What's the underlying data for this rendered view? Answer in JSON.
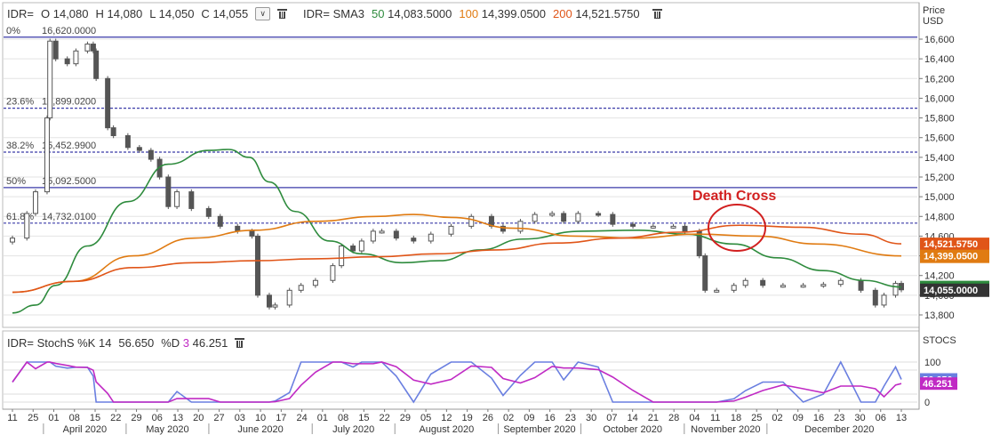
{
  "price_header": {
    "symbol": "IDR=",
    "o_label": "O",
    "o_val": "14,080",
    "h_label": "H",
    "h_val": "14,080",
    "l_label": "L",
    "l_val": "14,050",
    "c_label": "C",
    "c_val": "14,055",
    "dropdown_glyph": "∨",
    "sma_label": "IDR= SMA3",
    "sma50_period": "50",
    "sma50_val": "14,083.5000",
    "sma100_period": "100",
    "sma100_val": "14,399.0500",
    "sma200_period": "200",
    "sma200_val": "14,521.5750"
  },
  "price_axis_title": [
    "Price",
    "USD"
  ],
  "stoch_header": {
    "text": "IDR= StochS %K 14",
    "k_val": "56.650",
    "d_label": "%D",
    "d_period": "3",
    "d_val": "46.251"
  },
  "stoch_axis_title": "STOCS",
  "annotation": {
    "text": "Death Cross",
    "color": "#d22020"
  },
  "colors": {
    "candle": "#555555",
    "sma50": "#2e8b3d",
    "sma100": "#e07b12",
    "sma200": "#e05518",
    "fib": "#3a3aa8",
    "stoch_k": "#6a7fe0",
    "stoch_d": "#c02ac4",
    "last_price_bg": "#333333"
  },
  "fib_levels": [
    {
      "pct": "0%",
      "value": 16620.0,
      "label": "16,620.0000",
      "dashed": false
    },
    {
      "pct": "23.6%",
      "value": 15899.02,
      "label": "15,899.0200",
      "dashed": true
    },
    {
      "pct": "38.2%",
      "value": 15452.99,
      "label": "15,452.9900",
      "dashed": true
    },
    {
      "pct": "50%",
      "value": 15092.5,
      "label": "15,092.5000",
      "dashed": false
    },
    {
      "pct": "61.8%",
      "value": 14732.01,
      "label": "14,732.0100",
      "dashed": true
    }
  ],
  "price_badges": [
    {
      "value": 14521.575,
      "label": "14,521.5750",
      "color": "#e05518"
    },
    {
      "value": 14399.05,
      "label": "14,399.0500",
      "color": "#e07b12"
    },
    {
      "value": 14083.5,
      "label": "14,083.5000",
      "color": "#2e8b3d"
    },
    {
      "value": 14055.0,
      "label": "14,055.0000",
      "color": "#333333"
    }
  ],
  "stoch_badges": [
    {
      "value": 56.65,
      "label": "56.650",
      "color": "#6a7fe0"
    },
    {
      "value": 46.251,
      "label": "46.251",
      "color": "#c02ac4"
    }
  ],
  "x_axis": {
    "day_labels": [
      "11",
      "25",
      "01",
      "08",
      "15",
      "22",
      "29",
      "06",
      "13",
      "20",
      "27",
      "03",
      "10",
      "17",
      "24",
      "01",
      "08",
      "15",
      "22",
      "29",
      "05",
      "12",
      "19",
      "26",
      "02",
      "09",
      "16",
      "23",
      "30",
      "07",
      "14",
      "21",
      "28",
      "04",
      "11",
      "18",
      "25",
      "02",
      "09",
      "16",
      "23",
      "30",
      "06",
      "13"
    ],
    "months": [
      "April 2020",
      "May 2020",
      "June 2020",
      "July 2020",
      "August 2020",
      "September 2020",
      "October 2020",
      "November 2020",
      "December 2020"
    ]
  },
  "chart_data": {
    "type": "candlestick",
    "title": "",
    "xlabel": "",
    "ylabel": "Price USD",
    "ylim": [
      13700,
      16800
    ],
    "y_ticks": [
      13800,
      14000,
      14200,
      14400,
      14600,
      14800,
      15000,
      15200,
      15400,
      15600,
      15800,
      16000,
      16200,
      16400,
      16600
    ],
    "x_range": [
      "2020-03-11",
      "2021-01-13"
    ],
    "legend": "top-left",
    "grid": true,
    "close_series": [
      {
        "date": "2020-03-11",
        "value": 14580
      },
      {
        "date": "2020-03-16",
        "value": 14830
      },
      {
        "date": "2020-03-19",
        "value": 15050
      },
      {
        "date": "2020-03-23",
        "value": 15800
      },
      {
        "date": "2020-03-24",
        "value": 16580
      },
      {
        "date": "2020-03-26",
        "value": 16400
      },
      {
        "date": "2020-03-30",
        "value": 16350
      },
      {
        "date": "2020-04-02",
        "value": 16480
      },
      {
        "date": "2020-04-06",
        "value": 16550
      },
      {
        "date": "2020-04-08",
        "value": 16480
      },
      {
        "date": "2020-04-09",
        "value": 16200
      },
      {
        "date": "2020-04-13",
        "value": 15700
      },
      {
        "date": "2020-04-15",
        "value": 15620
      },
      {
        "date": "2020-04-20",
        "value": 15500
      },
      {
        "date": "2020-04-24",
        "value": 15470
      },
      {
        "date": "2020-04-28",
        "value": 15380
      },
      {
        "date": "2020-05-01",
        "value": 15200
      },
      {
        "date": "2020-05-04",
        "value": 14900
      },
      {
        "date": "2020-05-07",
        "value": 15050
      },
      {
        "date": "2020-05-12",
        "value": 14880
      },
      {
        "date": "2020-05-18",
        "value": 14800
      },
      {
        "date": "2020-05-22",
        "value": 14700
      },
      {
        "date": "2020-05-28",
        "value": 14650
      },
      {
        "date": "2020-06-02",
        "value": 14600
      },
      {
        "date": "2020-06-04",
        "value": 14000
      },
      {
        "date": "2020-06-08",
        "value": 13880
      },
      {
        "date": "2020-06-10",
        "value": 13900
      },
      {
        "date": "2020-06-15",
        "value": 14050
      },
      {
        "date": "2020-06-19",
        "value": 14100
      },
      {
        "date": "2020-06-24",
        "value": 14150
      },
      {
        "date": "2020-06-30",
        "value": 14300
      },
      {
        "date": "2020-07-03",
        "value": 14500
      },
      {
        "date": "2020-07-07",
        "value": 14450
      },
      {
        "date": "2020-07-10",
        "value": 14550
      },
      {
        "date": "2020-07-14",
        "value": 14650
      },
      {
        "date": "2020-07-17",
        "value": 14650
      },
      {
        "date": "2020-07-22",
        "value": 14580
      },
      {
        "date": "2020-07-28",
        "value": 14550
      },
      {
        "date": "2020-08-03",
        "value": 14620
      },
      {
        "date": "2020-08-10",
        "value": 14700
      },
      {
        "date": "2020-08-17",
        "value": 14800
      },
      {
        "date": "2020-08-24",
        "value": 14700
      },
      {
        "date": "2020-08-28",
        "value": 14650
      },
      {
        "date": "2020-09-03",
        "value": 14750
      },
      {
        "date": "2020-09-08",
        "value": 14820
      },
      {
        "date": "2020-09-14",
        "value": 14830
      },
      {
        "date": "2020-09-18",
        "value": 14750
      },
      {
        "date": "2020-09-23",
        "value": 14830
      },
      {
        "date": "2020-09-30",
        "value": 14820
      },
      {
        "date": "2020-10-05",
        "value": 14720
      },
      {
        "date": "2020-10-12",
        "value": 14700
      },
      {
        "date": "2020-10-19",
        "value": 14700
      },
      {
        "date": "2020-10-26",
        "value": 14700
      },
      {
        "date": "2020-10-30",
        "value": 14650
      },
      {
        "date": "2020-11-04",
        "value": 14400
      },
      {
        "date": "2020-11-06",
        "value": 14050
      },
      {
        "date": "2020-11-10",
        "value": 14050
      },
      {
        "date": "2020-11-16",
        "value": 14100
      },
      {
        "date": "2020-11-20",
        "value": 14150
      },
      {
        "date": "2020-11-26",
        "value": 14100
      },
      {
        "date": "2020-12-03",
        "value": 14100
      },
      {
        "date": "2020-12-10",
        "value": 14100
      },
      {
        "date": "2020-12-17",
        "value": 14110
      },
      {
        "date": "2020-12-23",
        "value": 14150
      },
      {
        "date": "2020-12-30",
        "value": 14050
      },
      {
        "date": "2021-01-04",
        "value": 13900
      },
      {
        "date": "2021-01-07",
        "value": 14000
      },
      {
        "date": "2021-01-11",
        "value": 14120
      },
      {
        "date": "2021-01-13",
        "value": 14055
      }
    ],
    "series": [
      {
        "name": "SMA 50",
        "points": [
          [
            "2020-03-11",
            13820
          ],
          [
            "2020-03-19",
            13900
          ],
          [
            "2020-03-26",
            14100
          ],
          [
            "2020-04-06",
            14500
          ],
          [
            "2020-04-20",
            14950
          ],
          [
            "2020-05-04",
            15330
          ],
          [
            "2020-05-18",
            15470
          ],
          [
            "2020-05-25",
            15480
          ],
          [
            "2020-06-01",
            15400
          ],
          [
            "2020-06-08",
            15150
          ],
          [
            "2020-06-17",
            14850
          ],
          [
            "2020-06-29",
            14550
          ],
          [
            "2020-07-10",
            14420
          ],
          [
            "2020-07-24",
            14330
          ],
          [
            "2020-08-06",
            14350
          ],
          [
            "2020-08-20",
            14460
          ],
          [
            "2020-09-04",
            14570
          ],
          [
            "2020-09-24",
            14650
          ],
          [
            "2020-10-14",
            14660
          ],
          [
            "2020-10-30",
            14620
          ],
          [
            "2020-11-16",
            14520
          ],
          [
            "2020-12-01",
            14380
          ],
          [
            "2020-12-17",
            14250
          ],
          [
            "2020-12-31",
            14150
          ],
          [
            "2021-01-13",
            14083.5
          ]
        ]
      },
      {
        "name": "SMA 100",
        "points": [
          [
            "2020-03-11",
            14030
          ],
          [
            "2020-04-01",
            14140
          ],
          [
            "2020-04-22",
            14400
          ],
          [
            "2020-05-13",
            14580
          ],
          [
            "2020-06-03",
            14660
          ],
          [
            "2020-06-24",
            14750
          ],
          [
            "2020-07-15",
            14800
          ],
          [
            "2020-07-28",
            14820
          ],
          [
            "2020-08-10",
            14790
          ],
          [
            "2020-09-01",
            14680
          ],
          [
            "2020-09-22",
            14600
          ],
          [
            "2020-10-13",
            14580
          ],
          [
            "2020-11-03",
            14620
          ],
          [
            "2020-11-24",
            14600
          ],
          [
            "2020-12-15",
            14520
          ],
          [
            "2021-01-13",
            14399.05
          ]
        ]
      },
      {
        "name": "SMA 200",
        "points": [
          [
            "2020-03-11",
            14030
          ],
          [
            "2020-04-01",
            14140
          ],
          [
            "2020-04-22",
            14280
          ],
          [
            "2020-05-13",
            14330
          ],
          [
            "2020-06-03",
            14350
          ],
          [
            "2020-06-24",
            14370
          ],
          [
            "2020-07-15",
            14390
          ],
          [
            "2020-08-05",
            14420
          ],
          [
            "2020-08-26",
            14460
          ],
          [
            "2020-09-16",
            14530
          ],
          [
            "2020-10-07",
            14580
          ],
          [
            "2020-10-28",
            14640
          ],
          [
            "2020-11-18",
            14710
          ],
          [
            "2020-12-09",
            14690
          ],
          [
            "2020-12-30",
            14620
          ],
          [
            "2021-01-13",
            14521.575
          ]
        ]
      }
    ],
    "stochastic": {
      "ylim": [
        -5,
        110
      ],
      "ref_lines": [
        0,
        20,
        80,
        100
      ],
      "k_period": 14,
      "d_period": 3,
      "k_last": 56.65,
      "d_last": 46.251
    }
  }
}
